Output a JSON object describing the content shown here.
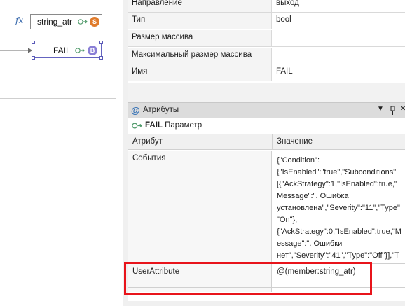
{
  "diagram": {
    "fx_label": "fx",
    "node1": {
      "label": "string_atr",
      "badge": "S",
      "badge_color": "#e07b2b"
    },
    "node2": {
      "label": "FAIL",
      "badge": "B",
      "badge_color": "#8a7fd6"
    }
  },
  "properties": {
    "rows": [
      {
        "key": "Направление",
        "value": "выход"
      },
      {
        "key": "Тип",
        "value": "bool"
      },
      {
        "key": "Размер массива",
        "value": ""
      },
      {
        "key": "Максимальный размер массива",
        "value": ""
      },
      {
        "key": "Имя",
        "value": "FAIL"
      }
    ]
  },
  "attributes_panel": {
    "title": "Атрибуты",
    "icon": "at-icon",
    "tools": {
      "dropdown": "▼",
      "pin": "📌",
      "close": "✕"
    },
    "subject_name": "FAIL",
    "subject_type": "Параметр",
    "columns": {
      "attribute": "Атрибут",
      "value": "Значение"
    },
    "rows": [
      {
        "key": "События",
        "value": "{\"Condition\":\n{\"IsEnabled\":\"true\",\"Subconditions\"\n[{\"AckStrategy\":1,\"IsEnabled\":true,\"\nMessage\":\". Ошибка\nустановлена\",\"Severity\":\"11\",\"Type\"\n\"On\"},\n{\"AckStrategy\":0,\"IsEnabled\":true,\"M\nessage\":\". Ошибки\nнет\",\"Severity\":\"41\",\"Type\":\"Off\"}],\"T\npe\":\"Discrete\"}}"
      },
      {
        "key": "UserAttribute",
        "value": "@(member:string_atr)"
      }
    ]
  },
  "colors": {
    "highlight": "#e8141b",
    "accent": "#2e6db4"
  }
}
